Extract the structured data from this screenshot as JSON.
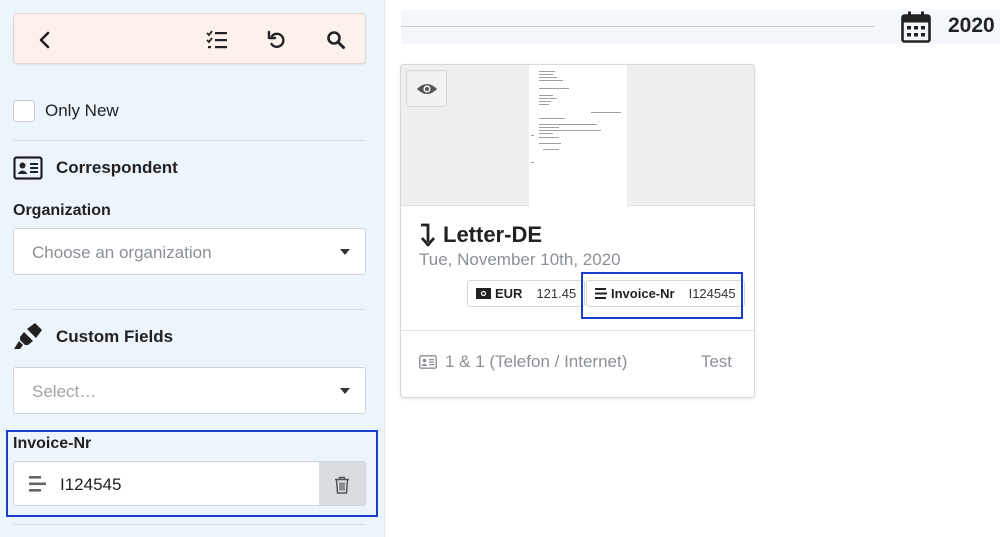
{
  "sidebar": {
    "toolbar": {
      "back_icon": "chevron-left-icon",
      "select_icon": "list-check-icon",
      "reset_icon": "undo-icon",
      "search_icon": "search-icon"
    },
    "only_new": {
      "label": "Only New",
      "checked": false
    },
    "correspondent": {
      "heading": "Correspondent",
      "organization_label": "Organization",
      "organization_placeholder": "Choose an organization"
    },
    "custom_fields": {
      "heading": "Custom Fields",
      "select_placeholder": "Select…"
    },
    "invoice_filter": {
      "label": "Invoice-Nr",
      "value": "I124545"
    }
  },
  "main": {
    "year": "2020",
    "card": {
      "title": "Letter-DE",
      "date": "Tue, November 10th, 2020",
      "tags": [
        {
          "key": "EUR",
          "value": "121.45"
        },
        {
          "key": "Invoice-Nr",
          "value": "I124545"
        }
      ],
      "correspondent": "1 & 1 (Telefon / Internet)",
      "tag": "Test"
    }
  },
  "colors": {
    "sidebar_bg": "#ecf5fc",
    "toolbar_bg": "#fdf1eb",
    "highlight": "#1a3ccf"
  }
}
